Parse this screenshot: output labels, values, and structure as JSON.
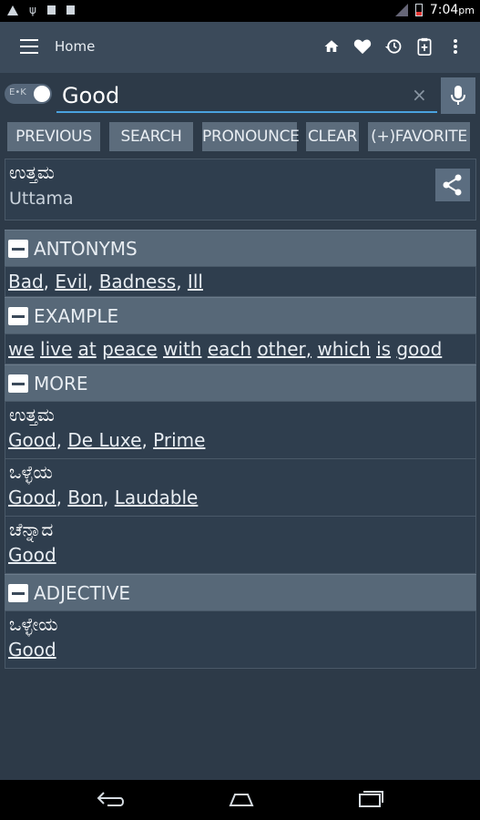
{
  "status": {
    "time": "7:04",
    "ampm": "pm"
  },
  "toolbar": {
    "title": "Home"
  },
  "search": {
    "toggle_label": "E•K",
    "value": "Good",
    "clear_glyph": "×"
  },
  "buttons": {
    "previous": "PREVIOUS",
    "search": "SEARCH",
    "pronounce": "PRONOUNCE",
    "clear": "CLEAR",
    "favorite": "(+)FAVORITE"
  },
  "word": {
    "kannada": "ಉತ್ತಮ",
    "translit": "Uttama"
  },
  "sections": {
    "antonyms": {
      "title": "ANTONYMS",
      "words": [
        "Bad",
        "Evil",
        "Badness",
        "Ill"
      ]
    },
    "example": {
      "title": "EXAMPLE",
      "words": [
        "we",
        "live",
        "at",
        "peace",
        "with",
        "each",
        "other,",
        "which",
        "is",
        "good"
      ]
    },
    "more": {
      "title": "MORE",
      "items": [
        {
          "kannada": "ಉತ್ತಮ",
          "words": [
            "Good",
            "De Luxe",
            "Prime"
          ]
        },
        {
          "kannada": "ಒಳ್ಳೆಯ",
          "words": [
            "Good",
            "Bon",
            "Laudable"
          ]
        },
        {
          "kannada": "ಚೆನ್ನಾದ",
          "words": [
            "Good"
          ]
        }
      ]
    },
    "adjective": {
      "title": "ADJECTIVE",
      "items": [
        {
          "kannada": "ಒಳ್ಳೇಯ",
          "words": [
            "Good"
          ]
        }
      ]
    }
  }
}
